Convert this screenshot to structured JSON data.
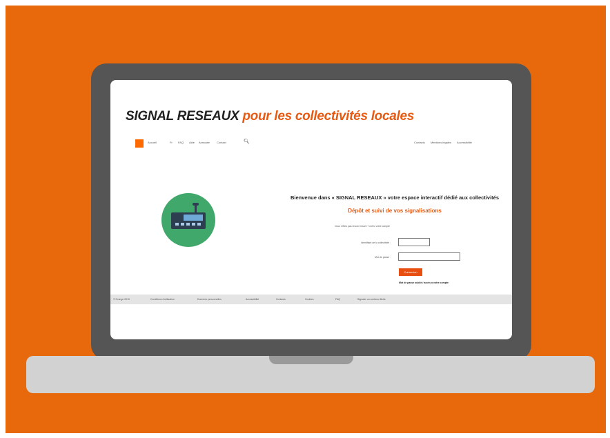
{
  "hero_title": {
    "part1": "SIGNAL RESEAUX",
    "part2": "pour les collectivités locales"
  },
  "nav": {
    "items": [
      "Accueil",
      "Fr",
      "FAQ",
      "Aide",
      "Annuaire",
      "Contact"
    ],
    "right_items": [
      "Contacts",
      "Mentions légales",
      "Accessibilité"
    ]
  },
  "welcome": {
    "title": "Bienvenue dans « SIGNAL RESEAUX » votre espace interactif dédié aux collectivités",
    "subtitle": "Dépôt et suivi de vos signalisations",
    "hint": "Vous n'êtes pas encore inscrit ? créez votre compte"
  },
  "login": {
    "username_label": "Identifiant de la collectivité :",
    "password_label": "Mot de passe :",
    "submit_label": "Connexion",
    "forgot_label": "Mot de passe oublié / accès à votre compte"
  },
  "footer": {
    "items": [
      "© Orange 2019",
      "Conditions d'utilisation",
      "Données personnelles",
      "Accessibilité",
      "Contacts",
      "Cookies",
      "FAQ",
      "Signaler un contenu illicite"
    ]
  },
  "colors": {
    "brand_orange": "#e8680c",
    "accent": "#e85a12",
    "hero_green": "#3fa86a"
  }
}
